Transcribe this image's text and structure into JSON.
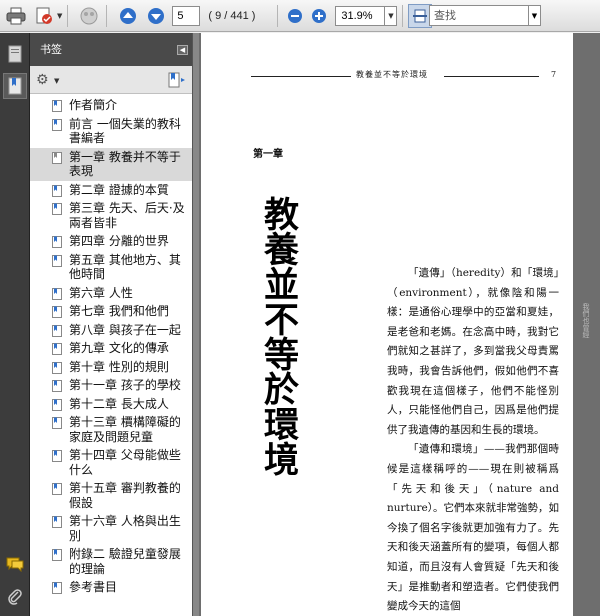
{
  "toolbar": {
    "current_page": "5",
    "page_count": "( 9 / 441 )",
    "zoom": "31.9%",
    "search_placeholder": "查找"
  },
  "panel": {
    "title": "书签"
  },
  "bookmarks": [
    {
      "label": "作者簡介",
      "selected": false
    },
    {
      "label": "前言 一個失業的教科書編者",
      "selected": false
    },
    {
      "label": "第一章 教養并不等于表現",
      "selected": true
    },
    {
      "label": "第二章 證據的本質",
      "selected": false
    },
    {
      "label": "第三章 先天、后天·及兩者皆非",
      "selected": false
    },
    {
      "label": "第四章 分離的世界",
      "selected": false
    },
    {
      "label": "第五章 其他地方、其他時間",
      "selected": false
    },
    {
      "label": "第六章 人性",
      "selected": false
    },
    {
      "label": "第七章 我們和他們",
      "selected": false
    },
    {
      "label": "第八章 與孩子在一起",
      "selected": false
    },
    {
      "label": "第九章 文化的傳承",
      "selected": false
    },
    {
      "label": "第十章 性別的規則",
      "selected": false
    },
    {
      "label": "第十一章 孩子的學校",
      "selected": false
    },
    {
      "label": "第十二章 長大成人",
      "selected": false
    },
    {
      "label": "第十三章 檟構障礙的家庭及問題兒童",
      "selected": false
    },
    {
      "label": "第十四章 父母能做些什么",
      "selected": false
    },
    {
      "label": "第十五章 審判教養的假設",
      "selected": false
    },
    {
      "label": "第十六章 人格與出生別",
      "selected": false
    },
    {
      "label": "附錄二 驗證兒童發展的理論",
      "selected": false
    },
    {
      "label": "參考書目",
      "selected": false
    }
  ],
  "document": {
    "running_title": "教養並不等於環境",
    "page_number": "7",
    "chapter_label": "第一章",
    "title": "教養並不等於環境",
    "paragraphs": [
      "「遺傳」（heredity）和「環境」（environment），就像陰和陽一樣：是通俗心理學中的亞當和夏娃，是老爸和老媽。在念高中時，我對它們就知之甚詳了，多到當我父母責罵我時，我會告訴他們，假如他們不喜歡我現在這個樣子，他們不能怪別人，只能怪他們自己，因爲是他們提供了我遺傳的基因和生長的環境。",
      "「遺傳和環境」——我們那個時候是這樣稱呼的——現在則被稱爲「先天和後天」（nature and nurture）。它們本來就非常強勢，如今換了個名字後就更加強有力了。先天和後天涵蓋所有的變項，每個人都知道，而且沒有人會質疑「先天和後天」是推動者和塑造者。它們使我們變成今天的這個"
    ],
    "margin_note": "我們也曾經"
  },
  "colors": {
    "toolbar_icon_blue": "#2f6fc9",
    "panel_header": "#4a4a4a",
    "rail": "#3c3c3c",
    "doc_background": "#6e6e6e"
  }
}
